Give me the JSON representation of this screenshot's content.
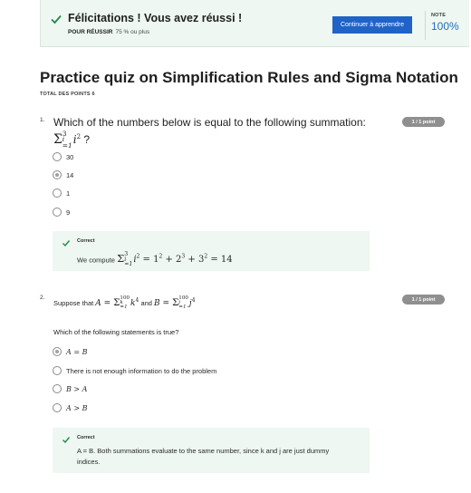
{
  "banner": {
    "title": "Félicitations ! Vous avez réussi !",
    "pass_label": "POUR RÉUSSIR",
    "pass_value": "75 % ou plus",
    "continue_label": "Continuer à apprendre",
    "note_label": "NOTE",
    "note_value": "100%"
  },
  "quiz": {
    "title": "Practice quiz on Simplification Rules and Sigma Notation",
    "total_points": "TOTAL DES POINTS 6"
  },
  "questions": [
    {
      "number": "1.",
      "prompt": "Which of the numbers below is equal to the following summation:",
      "prompt_math": "Σ_{i=1}^{3} i² ?",
      "points": "1 / 1 point",
      "options": [
        "30",
        "14",
        "1",
        "9"
      ],
      "selected_index": 1,
      "feedback_label": "Correct",
      "feedback_text_prefix": "We compute",
      "feedback_math": "Σ_{i=1}^{3} i² = 1² + 2³ + 3² = 14"
    },
    {
      "number": "2.",
      "prompt_prefix": "Suppose that",
      "prompt_math_a": "A = Σ_{k=1}^{100} k⁴",
      "prompt_and": "and",
      "prompt_math_b": "B = Σ_{j=1}^{100} j⁴",
      "question_line": "Which of the following statements is true?",
      "points": "1 / 1 point",
      "options": [
        "A = B",
        "There is not enough information to do the problem",
        "B > A",
        "A > B"
      ],
      "selected_index": 0,
      "feedback_label": "Correct",
      "feedback_text": "A = B. Both summations evaluate to the same number, since k and j are just dummy indices."
    }
  ],
  "colors": {
    "success_bg": "#eef7f1",
    "success_green": "#1f8a4c",
    "button_blue": "#1f63c8",
    "score_blue": "#1e6fc4",
    "pill_gray": "#8f8f8f"
  },
  "icons": {
    "banner_check": "check-icon",
    "feedback_check": "check-icon"
  }
}
